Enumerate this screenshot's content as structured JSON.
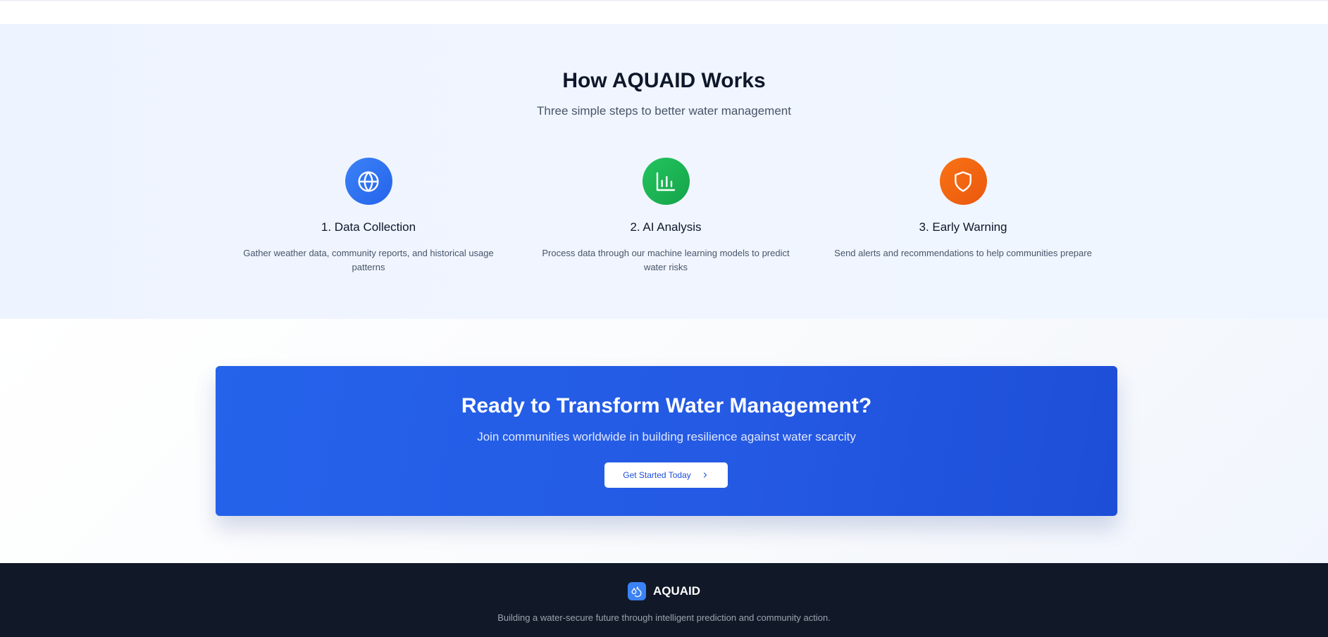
{
  "how_it_works": {
    "title": "How AQUAID Works",
    "subtitle": "Three simple steps to better water management",
    "steps": [
      {
        "icon": "globe-icon",
        "color": "#3b82f6",
        "title": "1. Data Collection",
        "description": "Gather weather data, community reports, and historical usage patterns"
      },
      {
        "icon": "bar-chart-icon",
        "color": "#22c55e",
        "title": "2. AI Analysis",
        "description": "Process data through our machine learning models to predict water risks"
      },
      {
        "icon": "shield-icon",
        "color": "#f97316",
        "title": "3. Early Warning",
        "description": "Send alerts and recommendations to help communities prepare"
      }
    ]
  },
  "cta": {
    "title": "Ready to Transform Water Management?",
    "subtitle": "Join communities worldwide in building resilience against water scarcity",
    "button_label": "Get Started Today",
    "button_icon": "chevron-right-icon",
    "color": "#2563eb"
  },
  "footer": {
    "logo_icon": "droplets-icon",
    "brand": "AQUAID",
    "tagline": "Building a water-secure future through intelligent prediction and community action."
  }
}
